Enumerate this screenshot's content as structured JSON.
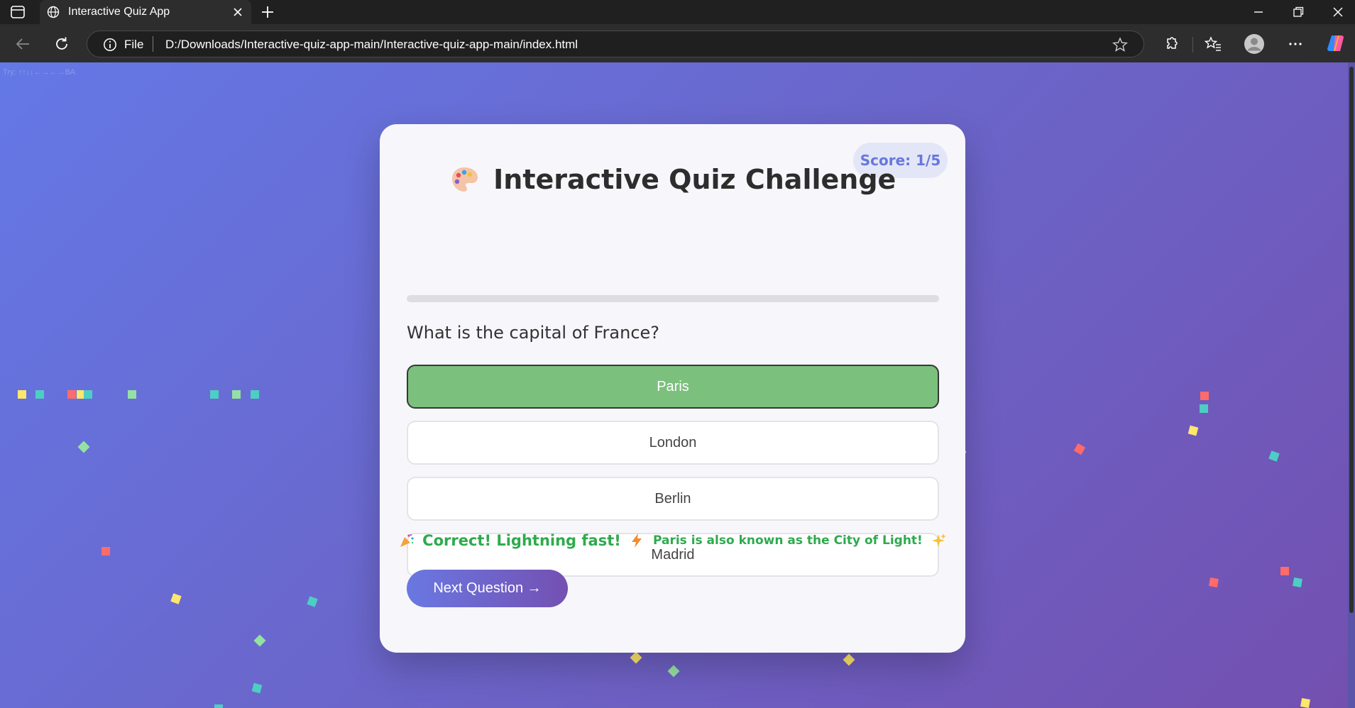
{
  "browser": {
    "tab_title": "Interactive Quiz App",
    "address_scheme": "File",
    "address_url": "D:/Downloads/Interactive-quiz-app-main/Interactive-quiz-app-main/index.html"
  },
  "page": {
    "corner_text": "Try: ↑↑↓↓←→←→BA"
  },
  "quiz": {
    "score_label": "Score: 1/5",
    "title": "Interactive Quiz Challenge",
    "progress_fraction": 0.0,
    "question": "What is the capital of France?",
    "options": [
      {
        "label": "Paris",
        "state": "correct"
      },
      {
        "label": "London",
        "state": "default"
      },
      {
        "label": "Berlin",
        "state": "default"
      },
      {
        "label": "Madrid",
        "state": "default"
      }
    ],
    "feedback": {
      "main": "Correct! Lightning fast!",
      "detail": "Paris is also known as the City of Light!"
    },
    "next_button": "Next Question →"
  },
  "colors": {
    "correct_green": "#7cc07e",
    "feedback_green": "#2eaa4e",
    "accent_blue": "#6677dd",
    "confetti": [
      "#ff6b6b",
      "#4ecdc4",
      "#ffe66d",
      "#95e1a3"
    ]
  },
  "icons": [
    "sidebar-icon",
    "globe-icon",
    "close-icon",
    "plus-icon",
    "back-icon",
    "reload-icon",
    "info-icon",
    "star-icon",
    "extensions-icon",
    "favorites-icon",
    "profile-icon",
    "more-icon",
    "copilot-icon",
    "palette-icon",
    "party-popper-icon",
    "lightning-icon",
    "sparkles-icon"
  ]
}
